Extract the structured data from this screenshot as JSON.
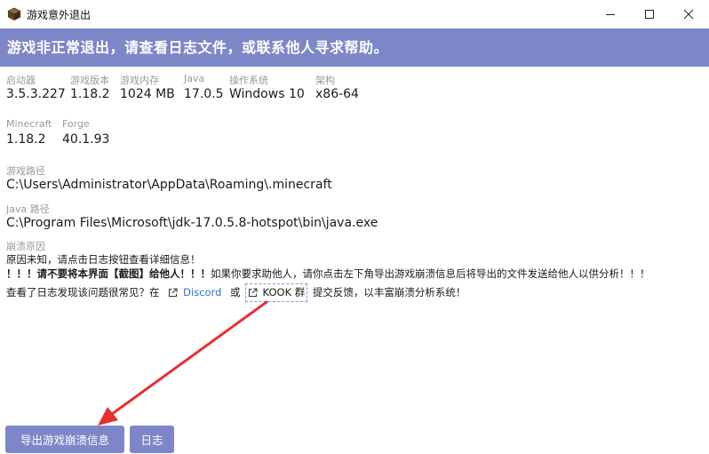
{
  "window": {
    "title": "游戏意外退出",
    "minimize_glyph": "—",
    "maximize_glyph": "☐",
    "close_glyph": "✕"
  },
  "banner": {
    "text": "游戏非正常退出，请查看日志文件，或联系他人寻求帮助。"
  },
  "info": {
    "launcher_label": "启动器",
    "launcher_value": "3.5.3.227",
    "game_version_label": "游戏版本",
    "game_version_value": "1.18.2",
    "memory_label": "游戏内存",
    "memory_value": "1024 MB",
    "java_label": "Java",
    "java_value": "17.0.5",
    "os_label": "操作系统",
    "os_value": "Windows 10",
    "arch_label": "架构",
    "arch_value": "x86-64",
    "minecraft_label": "Minecraft",
    "minecraft_value": "1.18.2",
    "forge_label": "Forge",
    "forge_value": "40.1.93",
    "game_path_label": "游戏路径",
    "game_path_value": "C:\\Users\\Administrator\\AppData\\Roaming\\.minecraft",
    "java_path_label": "Java 路径",
    "java_path_value": "C:\\Program Files\\Microsoft\\jdk-17.0.5.8-hotspot\\bin\\java.exe"
  },
  "crash": {
    "reason_label": "崩溃原因",
    "reason_text": "原因未知，请点击日志按钮查看详细信息！",
    "warning_bold": "！！！请不要将本界面【截图】给他人！！！",
    "warning_rest": "如果你要求助他人，请你点击左下角导出游戏崩溃信息后将导出的文件发送给他人以供分析！！！",
    "feedback_prefix": "查看了日志发现该问题很常见？在",
    "discord_label": "Discord",
    "or_text": "或",
    "kook_label": "KOOK 群",
    "feedback_suffix": "提交反馈，以丰富崩溃分析系统！"
  },
  "buttons": {
    "export_label": "导出游戏崩溃信息",
    "log_label": "日志"
  },
  "colors": {
    "accent": "#7d87c8",
    "link": "#2f6fd4",
    "arrow": "#e53030"
  },
  "icons": {
    "app": "minecraft-block-icon",
    "external_link": "external-link-icon"
  }
}
